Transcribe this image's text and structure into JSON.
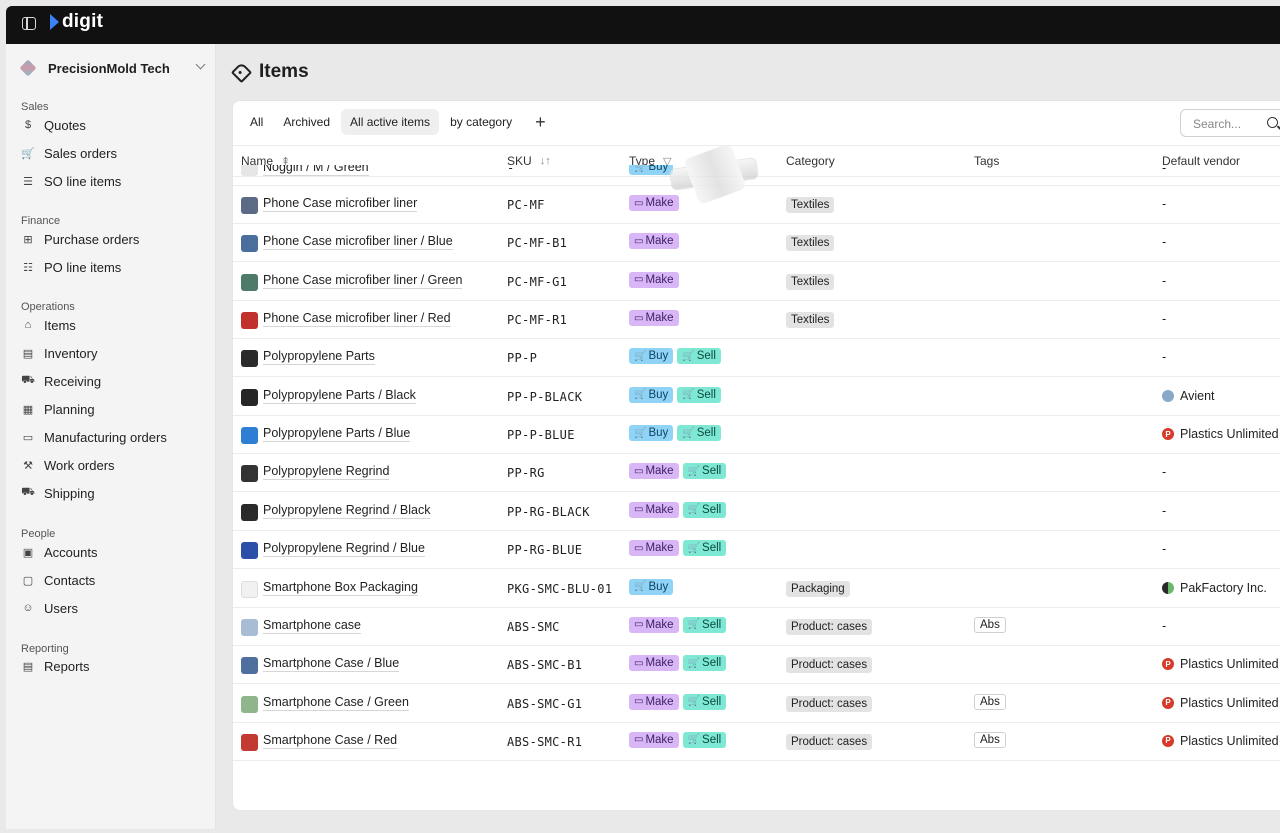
{
  "app": {
    "logo": "digit"
  },
  "sidebar": {
    "org": "PrecisionMold Tech",
    "sections": [
      {
        "label": "Sales",
        "items": [
          {
            "label": "Quotes",
            "icon": "dollar-doc-icon"
          },
          {
            "label": "Sales orders",
            "icon": "cart-icon"
          },
          {
            "label": "SO line items",
            "icon": "list-icon"
          }
        ]
      },
      {
        "label": "Finance",
        "items": [
          {
            "label": "Purchase orders",
            "icon": "shopping-bag-icon"
          },
          {
            "label": "PO line items",
            "icon": "checklist-icon"
          }
        ]
      },
      {
        "label": "Operations",
        "items": [
          {
            "label": "Items",
            "icon": "tag-icon"
          },
          {
            "label": "Inventory",
            "icon": "clipboard-icon"
          },
          {
            "label": "Receiving",
            "icon": "dolly-icon"
          },
          {
            "label": "Planning",
            "icon": "grid-icon"
          },
          {
            "label": "Manufacturing orders",
            "icon": "folder-icon"
          },
          {
            "label": "Work orders",
            "icon": "hammer-icon"
          },
          {
            "label": "Shipping",
            "icon": "truck-icon"
          }
        ]
      },
      {
        "label": "People",
        "items": [
          {
            "label": "Accounts",
            "icon": "building-icon"
          },
          {
            "label": "Contacts",
            "icon": "contact-card-icon"
          },
          {
            "label": "Users",
            "icon": "users-icon"
          }
        ]
      },
      {
        "label": "Reporting",
        "items": [
          {
            "label": "Reports",
            "icon": "report-icon"
          }
        ]
      }
    ]
  },
  "page": {
    "title": "Items"
  },
  "tabs": [
    "All",
    "Archived",
    "All active items",
    "by category"
  ],
  "active_tab": "All active items",
  "search": {
    "placeholder": "Search..."
  },
  "columns": {
    "name": "Name",
    "sku": "SKU",
    "type": "Type",
    "category": "Category",
    "tags": "Tags",
    "vendor": "Default vendor"
  },
  "partial_row": {
    "name": "Noggin / M / Green",
    "sku": "-",
    "type": "Buy",
    "vendor": "-"
  },
  "rows": [
    {
      "name": "Phone Case microfiber liner",
      "sku": "PC-MF",
      "types": [
        "Make"
      ],
      "category": "Textiles",
      "tag": "",
      "vendor": "-",
      "vendor_icon": "",
      "thumb": "#5b6b86"
    },
    {
      "name": "Phone Case microfiber liner / Blue",
      "sku": "PC-MF-B1",
      "types": [
        "Make"
      ],
      "category": "Textiles",
      "tag": "",
      "vendor": "-",
      "vendor_icon": "",
      "thumb": "#4a6f9c"
    },
    {
      "name": "Phone Case microfiber liner / Green",
      "sku": "PC-MF-G1",
      "types": [
        "Make"
      ],
      "category": "Textiles",
      "tag": "",
      "vendor": "-",
      "vendor_icon": "",
      "thumb": "#4e7a6a"
    },
    {
      "name": "Phone Case microfiber liner / Red",
      "sku": "PC-MF-R1",
      "types": [
        "Make"
      ],
      "category": "Textiles",
      "tag": "",
      "vendor": "-",
      "vendor_icon": "",
      "thumb": "#c0322b"
    },
    {
      "name": "Polypropylene Parts",
      "sku": "PP-P",
      "types": [
        "Buy",
        "Sell"
      ],
      "category": "",
      "tag": "",
      "vendor": "-",
      "vendor_icon": "",
      "thumb": "#2b2b2b"
    },
    {
      "name": "Polypropylene Parts / Black",
      "sku": "PP-P-BLACK",
      "types": [
        "Buy",
        "Sell"
      ],
      "category": "",
      "tag": "",
      "vendor": "Avient",
      "vendor_icon": "avient",
      "thumb": "#262626"
    },
    {
      "name": "Polypropylene Parts / Blue",
      "sku": "PP-P-BLUE",
      "types": [
        "Buy",
        "Sell"
      ],
      "category": "",
      "tag": "",
      "vendor": "Plastics Unlimited",
      "vendor_icon": "plast",
      "thumb": "#2e7fd4"
    },
    {
      "name": "Polypropylene Regrind",
      "sku": "PP-RG",
      "types": [
        "Make",
        "Sell"
      ],
      "category": "",
      "tag": "",
      "vendor": "-",
      "vendor_icon": "",
      "thumb": "#333333"
    },
    {
      "name": "Polypropylene Regrind / Black",
      "sku": "PP-RG-BLACK",
      "types": [
        "Make",
        "Sell"
      ],
      "category": "",
      "tag": "",
      "vendor": "-",
      "vendor_icon": "",
      "thumb": "#2a2a2a"
    },
    {
      "name": "Polypropylene Regrind / Blue",
      "sku": "PP-RG-BLUE",
      "types": [
        "Make",
        "Sell"
      ],
      "category": "",
      "tag": "",
      "vendor": "-",
      "vendor_icon": "",
      "thumb": "#2c4fa8"
    },
    {
      "name": "Smartphone Box Packaging",
      "sku": "PKG-SMC-BLU-01",
      "types": [
        "Buy"
      ],
      "category": "Packaging",
      "tag": "",
      "vendor": "PakFactory Inc.",
      "vendor_icon": "pak",
      "thumb": "#f1f1f1"
    },
    {
      "name": "Smartphone case",
      "sku": "ABS-SMC",
      "types": [
        "Make",
        "Sell"
      ],
      "category": "Product: cases",
      "tag": "Abs",
      "vendor": "-",
      "vendor_icon": "",
      "thumb": "#a9bcd6"
    },
    {
      "name": "Smartphone Case / Blue",
      "sku": "ABS-SMC-B1",
      "types": [
        "Make",
        "Sell"
      ],
      "category": "Product: cases",
      "tag": "",
      "vendor": "Plastics Unlimited",
      "vendor_icon": "plast",
      "thumb": "#4f6f9e"
    },
    {
      "name": "Smartphone Case / Green",
      "sku": "ABS-SMC-G1",
      "types": [
        "Make",
        "Sell"
      ],
      "category": "Product: cases",
      "tag": "Abs",
      "vendor": "Plastics Unlimited",
      "vendor_icon": "plast",
      "thumb": "#8fb58a"
    },
    {
      "name": "Smartphone Case / Red",
      "sku": "ABS-SMC-R1",
      "types": [
        "Make",
        "Sell"
      ],
      "category": "Product: cases",
      "tag": "Abs",
      "vendor": "Plastics Unlimited",
      "vendor_icon": "plast",
      "thumb": "#c23a32"
    }
  ],
  "colors": {
    "make": "#d9b6f5",
    "buy": "#8fd4f7",
    "sell": "#7ee8d4",
    "topbar": "#111111",
    "vendor_red": "#d63a2a"
  }
}
